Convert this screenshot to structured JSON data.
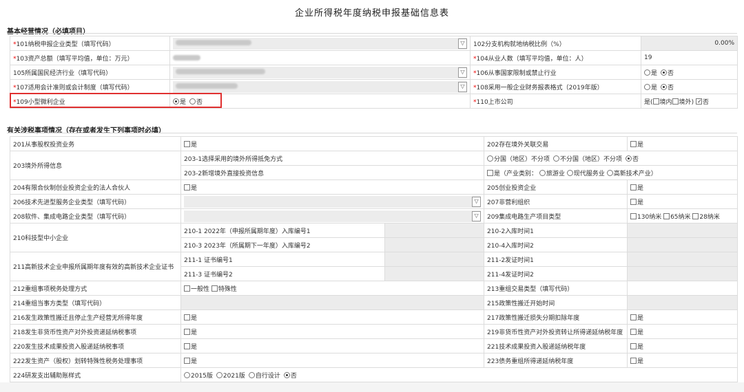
{
  "page": {
    "title": "企业所得税年度纳税申报基础信息表"
  },
  "section1": {
    "heading": "基本经营情况（必填项目）",
    "req_mark": "*",
    "f101": "101纳税申报企业类型（填写代码）",
    "f102": "102分支机构就地纳税比例（%）",
    "f102_value": "0.00%",
    "f103": "103资产总额（填写平均值，单位：万元）",
    "f104": "104从业人数（填写平均值，单位：人）",
    "f104_value": "19",
    "f105": "105所属国民经济行业（填写代码）",
    "f106": "106从事国家限制或禁止行业",
    "f107": "107适用会计准则或会计制度（填写代码）",
    "f108": "108采用一般企业财务报表格式（2019年版）",
    "f109": "109小型微利企业",
    "f110": "110上市公司",
    "yes": "是",
    "no": "否",
    "domestic": "境内",
    "overseas": "境外"
  },
  "section2": {
    "heading": "有关涉税事项情况（存在或者发生下列事项时必填）",
    "yes": "是",
    "no": "否",
    "f201": "201从事股权投资业务",
    "f202": "202存在境外关联交易",
    "f203": "203境外所得信息",
    "f203_1": "203-1选择采用的境外所得抵免方式",
    "f203_1_opt1": "分国（地区）不分项",
    "f203_1_opt2": "不分国（地区）不分项",
    "f203_2": "203-2新增境外直接投资信息",
    "f203_2_yes": "是（产业类别：",
    "f203_2_opt1": "旅游业",
    "f203_2_opt2": "现代服务业",
    "f203_2_opt3": "高新技术产业）",
    "f204": "204有限合伙制创业投资企业的法人合伙人",
    "f205": "205创业投资企业",
    "f206": "206技术先进型服务企业类型（填写代码）",
    "f207": "207非营利组织",
    "f208": "208软件、集成电路企业类型（填写代码）",
    "f209": "209集成电路生产项目类型",
    "f209_opt1": "130纳米",
    "f209_opt2": "65纳米",
    "f209_opt3": "28纳米",
    "f210": "210科技型中小企业",
    "f210_1": "210-1 2022年（申报所属期年度）入库编号1",
    "f210_2": "210-2入库时间1",
    "f210_3": "210-3 2023年（所属期下一年度）入库编号2",
    "f210_4": "210-4入库时间2",
    "f211": "211高新技术企业申报所属期年度有效的高新技术企业证书",
    "f211_1": "211-1 证书编号1",
    "f211_2": "211-2发证时间1",
    "f211_3": "211-3 证书编号2",
    "f211_4": "211-4发证时间2",
    "f212": "212重组事项税务处理方式",
    "f212_opt1": "一般性",
    "f212_opt2": "特殊性",
    "f213": "213重组交易类型（填写代码）",
    "f214": "214重组当事方类型（填写代码）",
    "f215": "215政策性搬迁开始时间",
    "f216": "216发生政策性搬迁且停止生产经营无所得年度",
    "f217": "217政策性搬迁损失分期扣除年度",
    "f218": "218发生非货币性资产对外投资递延纳税事项",
    "f219": "219非货币性资产对外投资转让所得递延纳税年度",
    "f220": "220发生技术成果投资入股递延纳税事项",
    "f221": "221技术成果投资入股递延纳税年度",
    "f222": "222发生资产（股权）划转特殊性税务处理事项",
    "f223": "223债务重组所得递延纳税年度",
    "f224": "224研发支出辅助账样式",
    "f224_opt1": "2015版",
    "f224_opt2": "2021版",
    "f224_opt3": "自行设计"
  },
  "icons": {
    "dropdown": "▽"
  }
}
